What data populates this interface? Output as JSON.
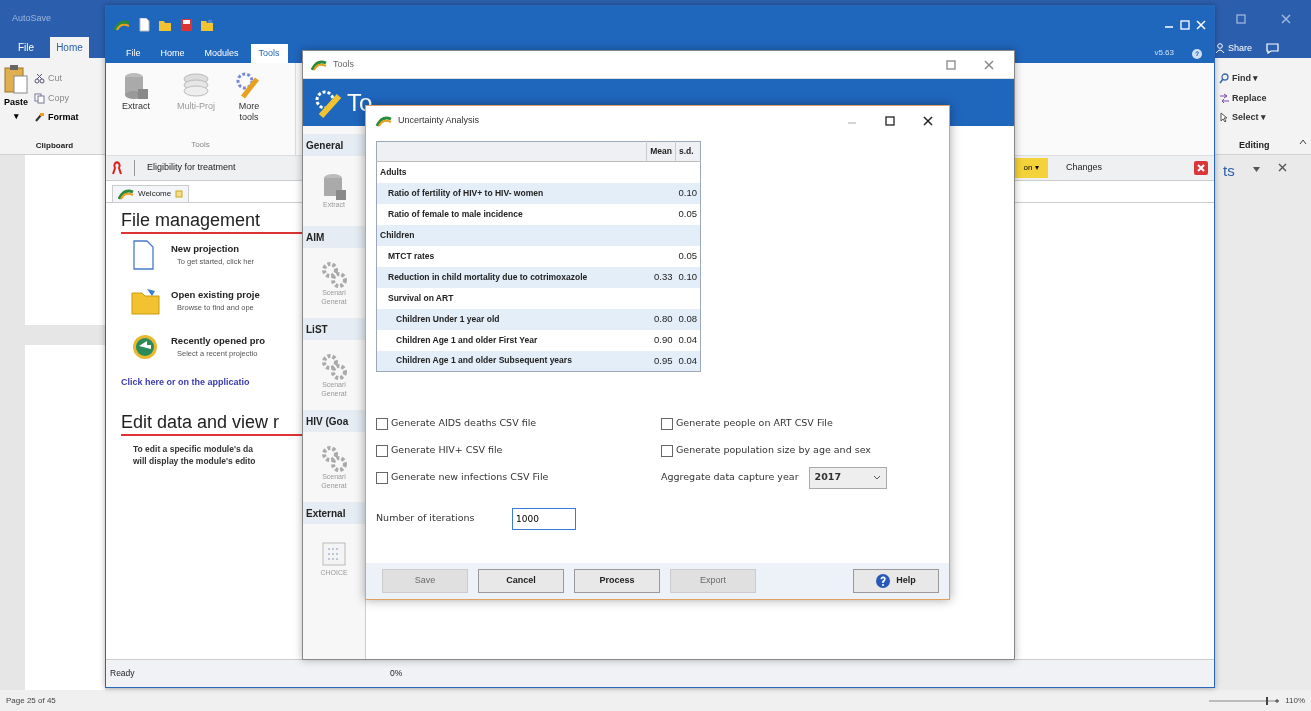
{
  "word": {
    "app_label": "AutoSave",
    "tabs": [
      {
        "label": "File",
        "selected": false
      },
      {
        "label": "Home",
        "selected": true
      }
    ],
    "clipboard": {
      "paste": "Paste",
      "paste_caret": "▾",
      "commands": [
        "Cut",
        "Copy",
        "Format"
      ],
      "group": "Clipboard"
    },
    "share": "Share",
    "editing": {
      "commands": [
        "Find ▾",
        "Replace",
        "Select ▾"
      ],
      "group": "Editing"
    },
    "pane": {
      "title": "ts"
    },
    "status_bar": {
      "page": "Page 25 of 45",
      "zoom": "110%"
    }
  },
  "spectrum": {
    "tabs": [
      {
        "label": "File",
        "selected": false
      },
      {
        "label": "Home",
        "selected": false
      },
      {
        "label": "Modules",
        "selected": false
      },
      {
        "label": "Tools",
        "selected": true
      }
    ],
    "version": "v5.63",
    "ribbon": {
      "buttons": [
        {
          "label": "Extract",
          "kind": "extract",
          "disabled": false
        },
        {
          "label": "Multi-Proj",
          "kind": "multi",
          "disabled": true
        },
        {
          "label": "More tools",
          "kind": "tools",
          "disabled": false
        }
      ],
      "group": "Tools"
    },
    "toolbar": {
      "module": "Eligibility for treatment",
      "dropdown": "on ▾",
      "changes": "Changes"
    },
    "doc_tab": "Welcome",
    "file_management": {
      "heading": "File management",
      "items": [
        {
          "kind": "new",
          "title": "New projection",
          "subtitle": "To get started, click her"
        },
        {
          "kind": "open",
          "title": "Open existing proje",
          "subtitle": "Browse to find and ope"
        },
        {
          "kind": "recent",
          "title": "Recently opened pro",
          "subtitle": "Select a recent projectio"
        }
      ],
      "link": "Click here or on the applicatio"
    },
    "edit_data": {
      "heading": "Edit data and view r",
      "lines": [
        "To edit a specific module's da",
        "will display the module's edito"
      ]
    },
    "status_bar": {
      "state": "Ready",
      "progress": "0%"
    }
  },
  "tools_window": {
    "title": "Tools",
    "header": "To",
    "sidebar": [
      {
        "heading": "General",
        "items": [
          {
            "kind": "extract",
            "label": "Extract"
          }
        ]
      },
      {
        "heading": "AIM",
        "items": [
          {
            "kind": "scenario",
            "label": "Scenari Generat"
          }
        ]
      },
      {
        "heading": "LiST",
        "items": [
          {
            "kind": "scenario",
            "label": "Scenari Generat"
          }
        ]
      },
      {
        "heading": "HIV (Goa",
        "items": [
          {
            "kind": "scenario",
            "label": "Scenari Generat"
          }
        ]
      },
      {
        "heading": "External",
        "items": [
          {
            "kind": "choice",
            "label": "CHOICE"
          }
        ]
      }
    ]
  },
  "dialog": {
    "title": "Uncertainty Analysis",
    "table": {
      "columns": [
        "Mean",
        "s.d."
      ],
      "rows": [
        {
          "label": "Adults",
          "children": [
            {
              "label": "Ratio of fertility of HIV+ to HIV- women",
              "sd": "0.10"
            },
            {
              "label": "Ratio of female to male incidence",
              "sd": "0.05"
            }
          ]
        },
        {
          "label": "Children",
          "children": [
            {
              "label": "MTCT rates",
              "sd": "0.05"
            },
            {
              "label": "Reduction in child mortality due to cotrimoxazole",
              "mean": "0.33",
              "sd": "0.10"
            },
            {
              "label": "Survival on ART",
              "children": [
                {
                  "label": "Children Under 1 year old",
                  "mean": "0.80",
                  "sd": "0.08"
                },
                {
                  "label": "Children Age 1 and older First Year",
                  "mean": "0.90",
                  "sd": "0.04"
                },
                {
                  "label": "Children Age 1 and older Subsequent years",
                  "mean": "0.95",
                  "sd": "0.04"
                }
              ]
            }
          ]
        }
      ]
    },
    "checkboxes_left": [
      {
        "label": "Generate AIDS deaths CSV file",
        "checked": false
      },
      {
        "label": "Generate HIV+ CSV file",
        "checked": false
      },
      {
        "label": "Generate new infections CSV File",
        "checked": false
      }
    ],
    "checkboxes_right": [
      {
        "label": "Generate people on ART CSV File",
        "checked": false
      },
      {
        "label": "Generate population size by age and sex",
        "checked": false
      }
    ],
    "capture_year": {
      "label": "Aggregate data capture year",
      "value": "2017"
    },
    "iterations": {
      "label": "Number of iterations",
      "value": "1000"
    },
    "buttons": [
      {
        "label": "Save",
        "disabled": true
      },
      {
        "label": "Cancel",
        "disabled": false
      },
      {
        "label": "Process",
        "disabled": false
      },
      {
        "label": "Export",
        "disabled": true
      }
    ],
    "help": "Help"
  }
}
